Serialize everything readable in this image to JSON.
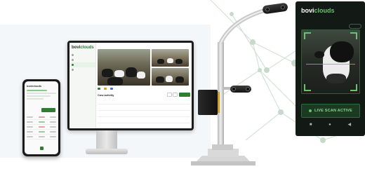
{
  "colors": {
    "brand_green": "#2f7d32",
    "accent_green": "#6cc070",
    "kiosk_bg": "#131a16"
  },
  "monitor_app": {
    "brand_prefix": "bovi",
    "brand_suffix": "clouds",
    "breadcrumb": "",
    "sidebar_items": [
      {
        "label": "",
        "active": false
      },
      {
        "label": "",
        "active": false
      },
      {
        "label": "",
        "active": true
      },
      {
        "label": "",
        "active": false
      }
    ],
    "legend": [
      {
        "label": "",
        "color": "#2f7d32"
      },
      {
        "label": "",
        "color": "#e0a020"
      },
      {
        "label": "",
        "color": "#3b6fd8"
      }
    ],
    "section_title": "Cow activity",
    "table_rows": [
      {
        "c1": "",
        "c2": "",
        "c3": "",
        "c4": "",
        "c5": ""
      },
      {
        "c1": "",
        "c2": "",
        "c3": "",
        "c4": "",
        "c5": ""
      },
      {
        "c1": "",
        "c2": "",
        "c3": "",
        "c4": "",
        "c5": ""
      }
    ]
  },
  "phone_app": {
    "brand": "boviclouds"
  },
  "kiosk": {
    "brand_prefix": "bovi",
    "brand_suffix": "clouds",
    "status": "",
    "chip": "",
    "scan_label": "LIVE SCAN ACTIVE",
    "nav_icons": [
      "square-icon",
      "circle-icon",
      "back-icon"
    ]
  }
}
